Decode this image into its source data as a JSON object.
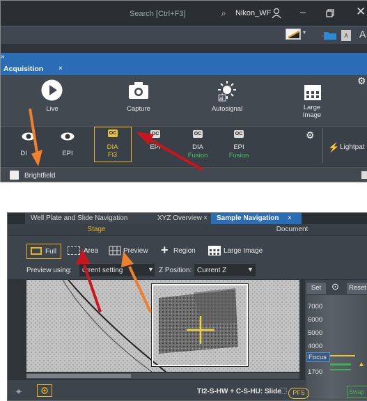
{
  "titlebar": {
    "search_placeholder": "Search [Ctrl+F3]",
    "user": "Nikon_WF",
    "letter_a_small": "A",
    "letter_a_large": "A"
  },
  "chevron": "»",
  "acquisition": {
    "tab_label": "Acquisition",
    "tab_close": "×",
    "buttons": [
      {
        "label": "Live"
      },
      {
        "label": "Capture"
      },
      {
        "label": "Autosignal"
      },
      {
        "label": "Large\nImage"
      }
    ],
    "modes": [
      {
        "label": "DIA",
        "sub": "",
        "visible_label": "DI",
        "icon": "eye-icon"
      },
      {
        "label": "EPI",
        "sub": "",
        "icon": "eye-icon"
      },
      {
        "label": "DIA",
        "sub": "Fi3",
        "icon": "oc-icon",
        "selected": true
      },
      {
        "label": "EPI",
        "sub": "",
        "icon": "oc-icon"
      },
      {
        "label": "DIA",
        "sub": "Fusion",
        "icon": "oc-icon"
      },
      {
        "label": "EPI",
        "sub": "Fusion",
        "icon": "oc-icon"
      }
    ],
    "lightpath": "Lightpat",
    "brightfield": "Brightfield",
    "colors": {
      "selected_border": "#e6b627",
      "fusion_text": "#4cc36b",
      "accent_blue": "#2a6db5"
    }
  },
  "navigation": {
    "tabs": [
      {
        "label": "Well Plate and Slide Navigation",
        "close": "×"
      },
      {
        "label": "XYZ Overview",
        "close": "×"
      },
      {
        "label": "Sample Navigation",
        "close": "×",
        "active": true
      }
    ],
    "subtabs": {
      "stage": "Stage",
      "document": "Document"
    },
    "tools": {
      "full": "Full",
      "area": "Area",
      "preview": "Preview",
      "region": "Region",
      "large_image": "Large Image"
    },
    "preview_using_label": "Preview using:",
    "preview_using_value": "urrent setting",
    "z_position_label": "Z Position:",
    "z_position_value": "Current Z",
    "zpanel": {
      "set": "Set",
      "reset": "Reset",
      "ticks": [
        "7000",
        "6000",
        "5000",
        "4000"
      ],
      "focus": "Focus",
      "value": "1700",
      "swap": "Swap"
    },
    "status": "TI2-S-HW + C-S-HU: Slide",
    "pfs": "PFS"
  },
  "annotations": {
    "arrow_red": "#c8161c",
    "arrow_orange": "#f07f2e",
    "crosshair": "#f2d534"
  }
}
